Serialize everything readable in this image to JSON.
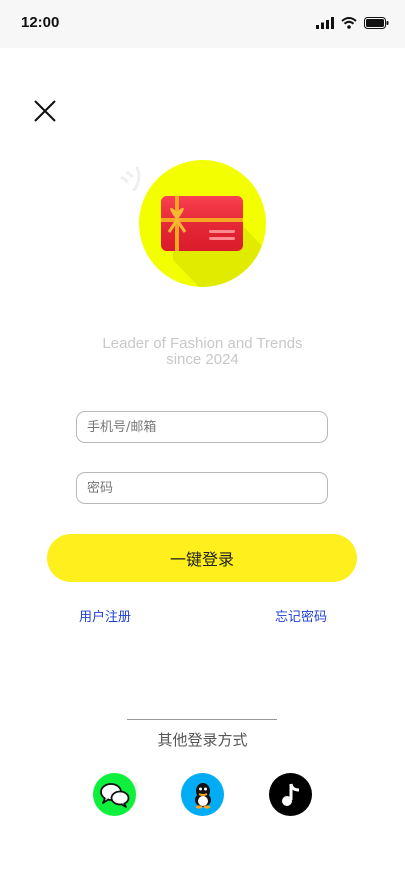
{
  "status_bar": {
    "time": "12:00"
  },
  "slogan": {
    "line1": "Leader of Fashion and Trends",
    "line2": "since 2024"
  },
  "form": {
    "phone_placeholder": "手机号/邮箱",
    "password_placeholder": "密码",
    "login_label": "一键登录"
  },
  "links": {
    "register": "用户注册",
    "forgot": "忘记密码"
  },
  "other_login": {
    "label": "其他登录方式",
    "providers": [
      "wechat-icon",
      "qq-icon",
      "tiktok-icon"
    ]
  },
  "colors": {
    "accent": "#ffef1c",
    "logo_circle": "#f3ff00",
    "link": "#1f3fd8",
    "wechat": "#0ff03c",
    "qq": "#00acf3",
    "tiktok": "#000000"
  }
}
